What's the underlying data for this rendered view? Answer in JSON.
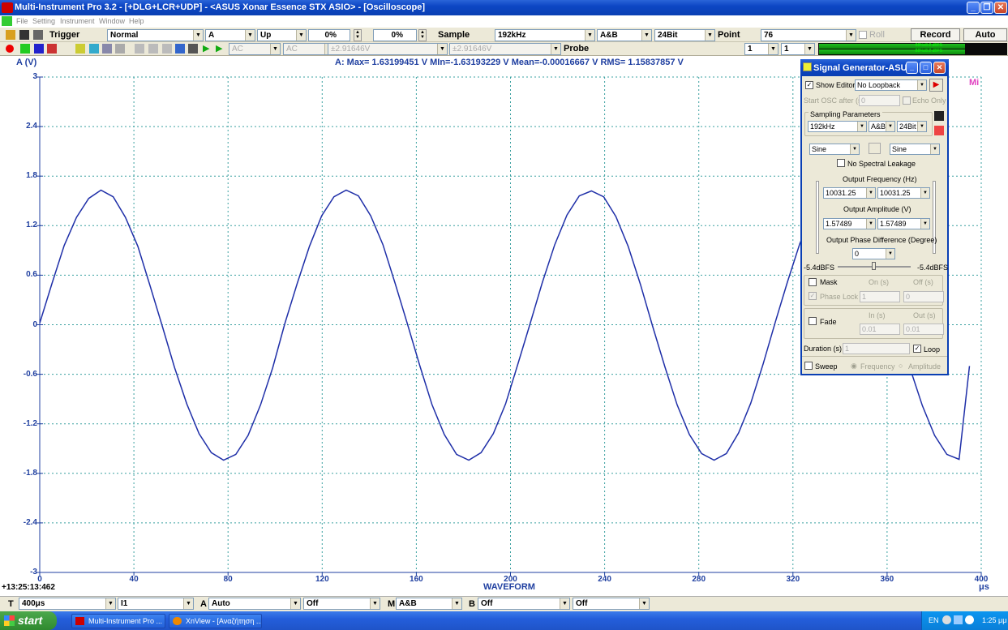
{
  "window": {
    "title": "Multi-Instrument Pro 3.2  - [+DLG+LCR+UDP]  - <ASUS Xonar Essence STX ASIO> - [Oscilloscope]",
    "minimize": "_",
    "restore": "❐",
    "close": "✕"
  },
  "menu": [
    "File",
    "Setting",
    "Instrument",
    "Window",
    "Help"
  ],
  "toolbar1": {
    "trigger_label": "Trigger",
    "trigger_mode": "Normal",
    "trigger_channel": "A",
    "trigger_edge": "Up",
    "pct1": "0%",
    "pct2": "0%",
    "sample_label": "Sample",
    "sample_rate": "192kHz",
    "channels": "A&B",
    "bit_depth": "24Bit",
    "point_label": "Point",
    "points": "76",
    "roll_label": "Roll",
    "record_label": "Record",
    "auto_label": "Auto"
  },
  "toolbar2": {
    "coupling_a": "AC",
    "coupling_b": "AC",
    "range_a": "±2.91646V",
    "range_b": "±2.91646V",
    "probe_label": "Probe",
    "probe_a": "1",
    "probe_b": "1",
    "meter_a": "88¾±8.2 dBFS",
    "meter_b": "88¾±8.2 dBFS"
  },
  "scope": {
    "y_unit": "A (V)",
    "stats": "A: Max= 1.63199451 V  MIn=-1.63193229 V  Mean=-0.00016667 V  RMS= 1.15837857 V",
    "timestamp": "+13:25:13:462",
    "x_title": "WAVEFORM",
    "x_unit": "μs",
    "corner_tag": "Mi",
    "trace_color": "#1f2fa8",
    "grid_color": "#3aa0a0"
  },
  "bottom": {
    "t_label": "T",
    "t_value": "400μs",
    "ch_value": "I1",
    "a_label": "A",
    "a_value": "Auto",
    "off1": "Off",
    "m_label": "M",
    "m_value": "A&B",
    "b_label": "B",
    "b_value": "Off",
    "off2": "Off"
  },
  "taskbar": {
    "start": "start",
    "task1": "Multi-Instrument Pro ...",
    "task2": "XnView - [Αναζήτηση ...",
    "lang": "EN",
    "clock": "1:25 μμ"
  },
  "siggen": {
    "title": "Signal Generator-ASU...",
    "show_editor": "Show Editor",
    "loopback": "No Loopback",
    "start_osc": "Start OSC after (s)",
    "start_osc_value": "0",
    "echo_only": "Echo Only",
    "sampling_params": "Sampling Parameters",
    "rate": "192kHz",
    "channels": "A&B",
    "bits": "24Bit",
    "wave_a": "Sine",
    "wave_b": "Sine",
    "no_leakage": "No Spectral Leakage",
    "freq_label": "Output Frequency (Hz)",
    "freq_a": "10031.25",
    "freq_b": "10031.25",
    "amp_label": "Output Amplitude (V)",
    "amp_a": "1.57489",
    "amp_b": "1.57489",
    "phase_label": "Output Phase Difference (Degree)",
    "phase": "0",
    "dbfs_a": "-5.4dBFS",
    "dbfs_b": "-5.4dBFS",
    "mask": "Mask",
    "on_s": "On (s)",
    "off_s": "Off (s)",
    "phase_lock": "Phase Lock",
    "mask_on_value": "1",
    "mask_off_value": "0",
    "fade": "Fade",
    "in_s": "In (s)",
    "out_s": "Out (s)",
    "fade_in_value": "0.01",
    "fade_out_value": "0.01",
    "duration": "Duration (s)",
    "duration_value": "1",
    "loop": "Loop",
    "sweep": "Sweep",
    "frequency": "Frequency",
    "amplitude": "Amplitude"
  },
  "chart_data": {
    "type": "line",
    "title": "",
    "xlabel": "WAVEFORM",
    "ylabel": "A (V)",
    "x_unit": "μs",
    "xlim": [
      0,
      400
    ],
    "ylim": [
      -3,
      3
    ],
    "xticks": [
      0,
      40,
      80,
      120,
      160,
      200,
      240,
      280,
      320,
      360,
      400
    ],
    "yticks": [
      3,
      2.4,
      1.8,
      1.2,
      0.6,
      0,
      -0.6,
      -1.2,
      -1.8,
      -2.4,
      -3
    ],
    "ytick_labels": [
      "3",
      "2.4",
      "1.8",
      "1.2",
      "0.6",
      "0",
      "-0.6",
      "-1.2",
      "-1.8",
      "-2.4",
      "-3"
    ],
    "grid": true,
    "series": [
      {
        "name": "A",
        "amplitude": 1.632,
        "period_us": 99.69,
        "x_end": 395,
        "x": [
          0,
          5.2,
          10.4,
          15.6,
          20.8,
          26,
          31.2,
          36.4,
          41.7,
          46.9,
          52.1,
          57.3,
          62.5,
          67.7,
          72.9,
          78.1,
          83.3,
          88.5,
          93.8,
          99,
          104.2,
          109.4,
          114.6,
          119.8,
          125,
          130.2,
          135.4,
          140.6,
          145.8,
          151,
          156.2,
          161.5,
          166.7,
          171.9,
          177.1,
          182.3,
          187.5,
          192.7,
          197.9,
          203.1,
          208.3,
          213.5,
          218.8,
          224,
          229.2,
          234.4,
          239.6,
          244.8,
          250,
          255.2,
          260.4,
          265.6,
          270.8,
          276,
          281.2,
          286.5,
          291.7,
          296.9,
          302.1,
          307.3,
          312.5,
          317.7,
          322.9,
          328.1,
          333.3,
          338.5,
          343.8,
          349,
          354.2,
          359.4,
          364.6,
          369.8,
          375,
          380.2,
          385.4,
          390.6,
          395
        ],
        "y": [
          0.02,
          0.5,
          0.96,
          1.3,
          1.53,
          1.63,
          1.55,
          1.3,
          0.95,
          0.47,
          -0.02,
          -0.52,
          -0.96,
          -1.32,
          -1.55,
          -1.64,
          -1.57,
          -1.34,
          -0.97,
          -0.52,
          0.02,
          0.5,
          0.95,
          1.32,
          1.55,
          1.63,
          1.56,
          1.32,
          0.97,
          0.5,
          0.01,
          -0.5,
          -0.97,
          -1.33,
          -1.57,
          -1.64,
          -1.55,
          -1.32,
          -0.96,
          -0.48,
          0.01,
          0.51,
          0.97,
          1.33,
          1.56,
          1.62,
          1.55,
          1.31,
          0.95,
          0.49,
          -0.02,
          -0.51,
          -0.97,
          -1.33,
          -1.56,
          -1.64,
          -1.56,
          -1.31,
          -0.95,
          -0.48,
          0.03,
          0.52,
          0.98,
          1.34,
          1.56,
          1.62,
          1.54,
          1.3,
          0.93,
          0.46,
          -0.04,
          -0.53,
          -0.98,
          -1.34,
          -1.57,
          -1.63,
          -0.5
        ]
      }
    ]
  }
}
